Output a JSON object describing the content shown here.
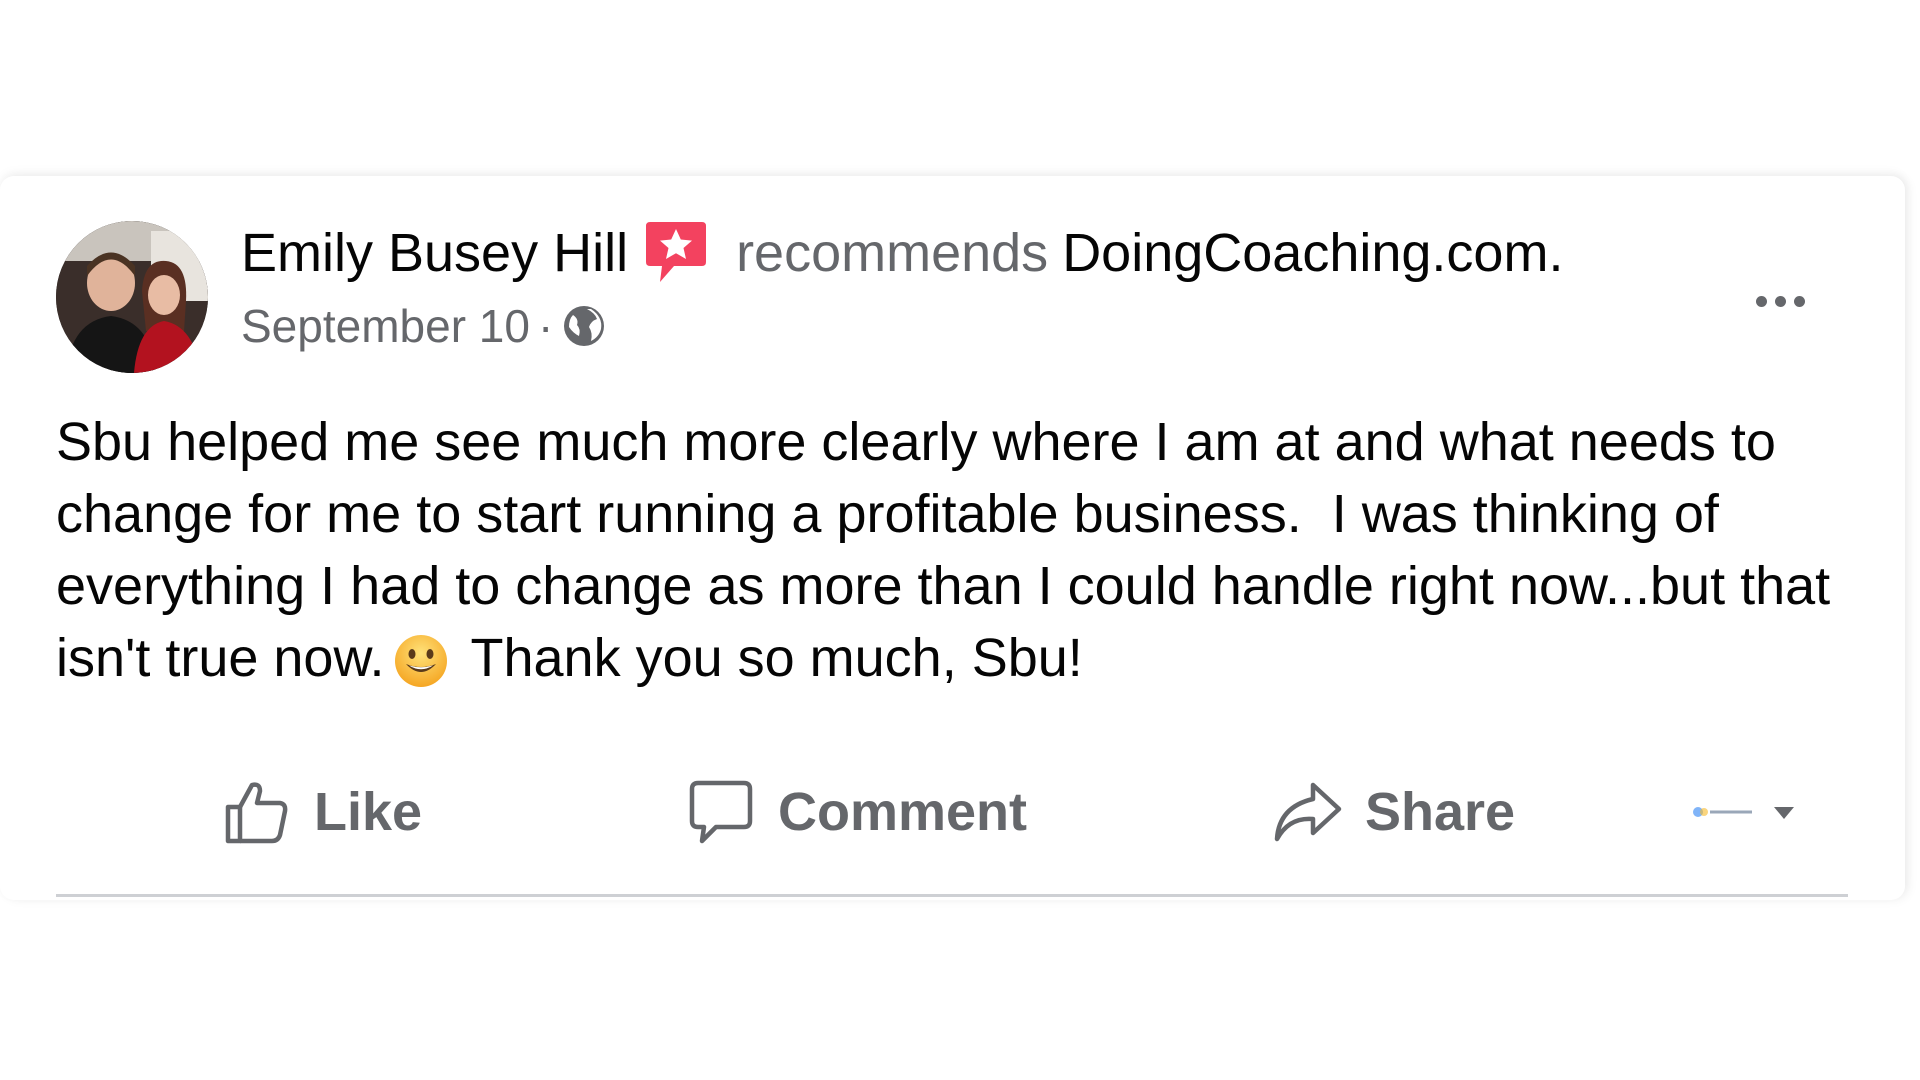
{
  "post": {
    "author": "Emily Busey Hill",
    "recommends_text": "recommends",
    "page_name": "DoingCoaching.com.",
    "date": "September 10",
    "separator": "·",
    "body": "Sbu helped me see much more clearly where I am at and what needs to change for me to start running a profitable business.  I was thinking of everything I had to change as more than I could handle right now...but that isn't true now.",
    "body_after_emoji": "Thank you so much, Sbu!",
    "icons": {
      "recommend_badge": "recommend-star-icon",
      "audience": "globe-icon",
      "emoji": "smiley-emoji-icon",
      "more": "more-options-icon"
    }
  },
  "actions": {
    "like_label": "Like",
    "comment_label": "Comment",
    "share_label": "Share"
  },
  "colors": {
    "primary_text": "#050505",
    "secondary_text": "#65676b",
    "recommend_badge": "#f3425f",
    "divider": "#ced0d4"
  }
}
